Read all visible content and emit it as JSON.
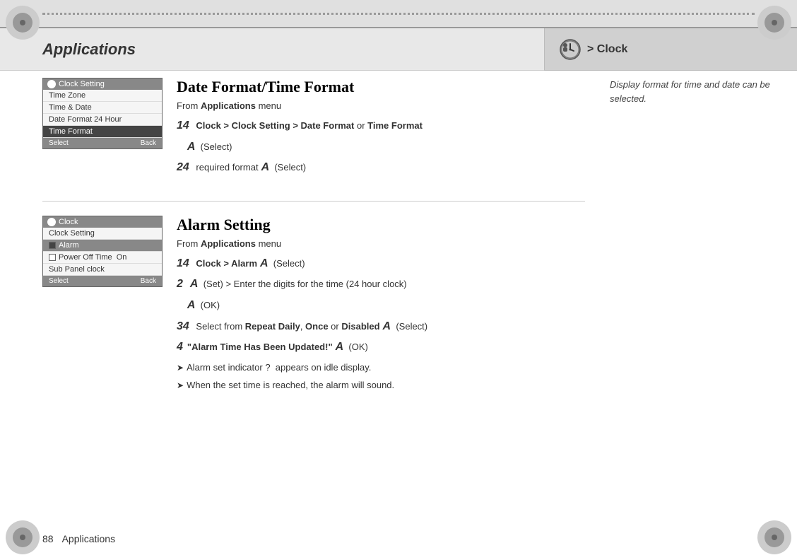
{
  "header": {
    "title": "Applications",
    "right_label": "> Clock"
  },
  "sidebar_note": "Display format for time and date can be selected.",
  "section1": {
    "title": "Date Format/Time Format",
    "from_line": "From Applications menu",
    "steps": [
      {
        "num": "14",
        "text": "Clock > Clock Setting > Date Format or Time Format"
      },
      {
        "a": "A",
        "text": "(Select)"
      },
      {
        "num": "24",
        "text": "required format",
        "a": "A",
        "text2": "(Select)"
      }
    ],
    "phone_screen": {
      "header": "Clock Setting",
      "rows": [
        {
          "label": "Time Zone",
          "selected": false
        },
        {
          "label": "Time & Date",
          "selected": false
        },
        {
          "label": "Date Format 24 Hour",
          "selected": false
        },
        {
          "label": "Time Format",
          "selected": true
        }
      ],
      "footer_left": "Select",
      "footer_right": "Back"
    }
  },
  "section2": {
    "title": "Alarm Setting",
    "from_line": "From Applications menu",
    "steps": [
      {
        "num": "14",
        "text": "Clock > Alarm",
        "a": "A",
        "text2": "(Select)"
      },
      {
        "num": "2",
        "a": "A",
        "text": "(Set) > Enter the digits for the time (24 hour clock)"
      },
      {
        "a2": "A",
        "text": "(OK)"
      },
      {
        "num": "34",
        "text": "Select from Repeat Daily, Once or Disabled",
        "a": "A",
        "text2": "(Select)"
      },
      {
        "num": "4",
        "quoted": "\"Alarm Time Has Been Updated!\"",
        "a": "A",
        "text": "(OK)"
      }
    ],
    "bullets": [
      "Alarm set indicator ?  appears on idle display.",
      "When the set time is reached, the alarm will sound."
    ],
    "phone_screen": {
      "header": "Clock",
      "rows": [
        {
          "label": "Clock Setting",
          "selected": false,
          "indent": false
        },
        {
          "label": "Alarm",
          "selected": true,
          "indent": true
        },
        {
          "label": "Power Off Time  On",
          "selected": false,
          "indent": false,
          "checkbox": true
        },
        {
          "label": "Sub Panel clock",
          "selected": false,
          "indent": false
        }
      ],
      "footer_left": "Select",
      "footer_right": "Back"
    }
  },
  "footer": {
    "page_num": "88",
    "page_label": "Applications"
  }
}
